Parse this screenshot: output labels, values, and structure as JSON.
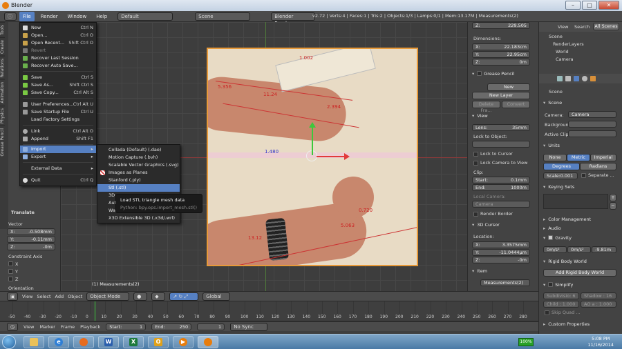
{
  "window": {
    "title": "Blender"
  },
  "topbar": {
    "menus": [
      "File",
      "Render",
      "Window",
      "Help"
    ],
    "layout": "Default",
    "scene": "Scene",
    "engine": "Blender Render",
    "stats": "v2.72 | Verts:4 | Faces:1 | Tris:2 | Objects:1/3 | Lamps:0/1 | Mem:13.17M | Measurements(2)"
  },
  "file_menu": {
    "items": [
      {
        "label": "New",
        "shortcut": "Ctrl N"
      },
      {
        "label": "Open...",
        "shortcut": "Ctrl O"
      },
      {
        "label": "Open Recent...",
        "shortcut": "Shift Ctrl O"
      },
      {
        "label": "Revert",
        "shortcut": ""
      },
      {
        "label": "Recover Last Session",
        "shortcut": ""
      },
      {
        "label": "Recover Auto Save...",
        "shortcut": ""
      },
      {
        "label": "Save",
        "shortcut": "Ctrl S"
      },
      {
        "label": "Save As...",
        "shortcut": "Shift Ctrl S"
      },
      {
        "label": "Save Copy...",
        "shortcut": "Ctrl Alt S"
      },
      {
        "label": "User Preferences...",
        "shortcut": "Ctrl Alt U"
      },
      {
        "label": "Save Startup File",
        "shortcut": "Ctrl U"
      },
      {
        "label": "Load Factory Settings",
        "shortcut": ""
      },
      {
        "label": "Link",
        "shortcut": "Ctrl Alt O"
      },
      {
        "label": "Append",
        "shortcut": "Shift F1"
      },
      {
        "label": "Import",
        "shortcut": ""
      },
      {
        "label": "Export",
        "shortcut": ""
      },
      {
        "label": "External Data",
        "shortcut": ""
      },
      {
        "label": "Quit",
        "shortcut": "Ctrl Q"
      }
    ]
  },
  "import_menu": {
    "items": [
      "Collada (Default) (.dae)",
      "Motion Capture (.bvh)",
      "Scalable Vector Graphics (.svg)",
      "Images as Planes",
      "Stanford (.ply)",
      "Stl (.stl)",
      "3D",
      "Auto",
      "Wav",
      "X3D Extensible 3D (.x3d/.wrl)"
    ]
  },
  "tooltip": {
    "title": "Load STL triangle mesh data",
    "python": "Python: bpy.ops.import_mesh.stl()"
  },
  "measurements": {
    "m1": "1.002",
    "m2": "5.356",
    "m3": "11.24",
    "m4": "2.394",
    "m5": "1.480",
    "m6": "0.720",
    "m7": "5.063",
    "m8": "13.12"
  },
  "viewport": {
    "object_label": "(1) Measurements(2)"
  },
  "left_panel": {
    "title": "Translate",
    "vector_label": "Vector",
    "x": "X:",
    "x_val": "-0.508mm",
    "y": "Y:",
    "y_val": "-0.11mm",
    "z": "Z:",
    "z_val": "-0m",
    "constraint_label": "Constraint Axis",
    "cx": "X",
    "cy": "Y",
    "cz": "Z",
    "orientation": "Orientation",
    "tabs": [
      "Tools",
      "Create",
      "Relations",
      "Animation",
      "Physics",
      "Grease Pencil"
    ]
  },
  "npanel": {
    "z": "Z:",
    "z_val": "229.505",
    "dimensions": "Dimensions:",
    "dx": "X:",
    "dx_val": "22.183cm",
    "dy": "Y:",
    "dy_val": "22.95cm",
    "dz": "Z:",
    "dz_val": "0m",
    "grease": "Grease Pencil",
    "new": "New",
    "new_layer": "New Layer",
    "delete_frame": "Delete Fra...",
    "convert": "Convert",
    "view": "View",
    "lens_label": "Lens:",
    "lens": "35mm",
    "lock_object": "Lock to Object:",
    "lock_cursor": "Lock to Cursor",
    "lock_camera": "Lock Camera to View",
    "clip": "Clip:",
    "start_label": "Start:",
    "start": "0.1mm",
    "end_label": "End:",
    "end": "1000m",
    "local_camera": "Local Camera:",
    "camera": "Camera",
    "render_border": "Render Border",
    "cursor3d": "3D Cursor",
    "location": "Location:",
    "lx": "X:",
    "lx_val": "3.3575mm",
    "ly": "Y:",
    "ly_val": "-11.0444μm",
    "lz": "Z:",
    "lz_val": "-0m",
    "item": "Item",
    "item_name": "Measurements(2)"
  },
  "outliner": {
    "view": "View",
    "search": "Search",
    "all_scenes": "All Scenes",
    "rows": [
      "Scene",
      "RenderLayers",
      "World",
      "Camera"
    ]
  },
  "properties": {
    "scene_label": "Scene",
    "scene_section": "Scene",
    "camera_label": "Camera:",
    "camera": "Camera",
    "background_label": "Backgroun",
    "active_clip": "Active Clip",
    "units": "Units",
    "none": "None",
    "metric": "Metric",
    "imperial": "Imperial",
    "degrees": "Degrees",
    "radians": "Radians",
    "scale": "Scale:0.001",
    "separate": "Separate ...",
    "keying_sets": "Keying Sets",
    "color_mgmt": "Color Management",
    "audio": "Audio",
    "gravity": "Gravity",
    "gx": "0m/s²",
    "gy": "0m/s²",
    "gz": "-9.81m",
    "rigid": "Rigid Body World",
    "add_rigid": "Add Rigid Body World",
    "simplify": "Simplify",
    "subdiv": "Subdivisio: 6",
    "shadow": "Shadow : 16",
    "child": "Child : 1.000",
    "ao": "AO a : 1.000",
    "skip": "Skip Quad ...",
    "custom": "Custom Properties"
  },
  "vp_header": {
    "view": "View",
    "select": "Select",
    "add": "Add",
    "object": "Object",
    "mode": "Object Mode",
    "global": "Global"
  },
  "timeline": {
    "ticks": [
      "-50",
      "-40",
      "-30",
      "-20",
      "-10",
      "0",
      "10",
      "20",
      "30",
      "40",
      "50",
      "60",
      "70",
      "80",
      "90",
      "100",
      "110",
      "120",
      "130",
      "140",
      "150",
      "160",
      "170",
      "180",
      "190",
      "200",
      "210",
      "220",
      "230",
      "240",
      "250",
      "260",
      "270",
      "280"
    ],
    "view": "View",
    "marker": "Marker",
    "frame": "Frame",
    "playback": "Playback",
    "start": "Start:",
    "start_val": "1",
    "end": "End:",
    "end_val": "250",
    "current": "1",
    "sync": "No Sync"
  },
  "taskbar": {
    "battery": "100%",
    "time": "5:08 PM",
    "date": "11/16/2014"
  }
}
